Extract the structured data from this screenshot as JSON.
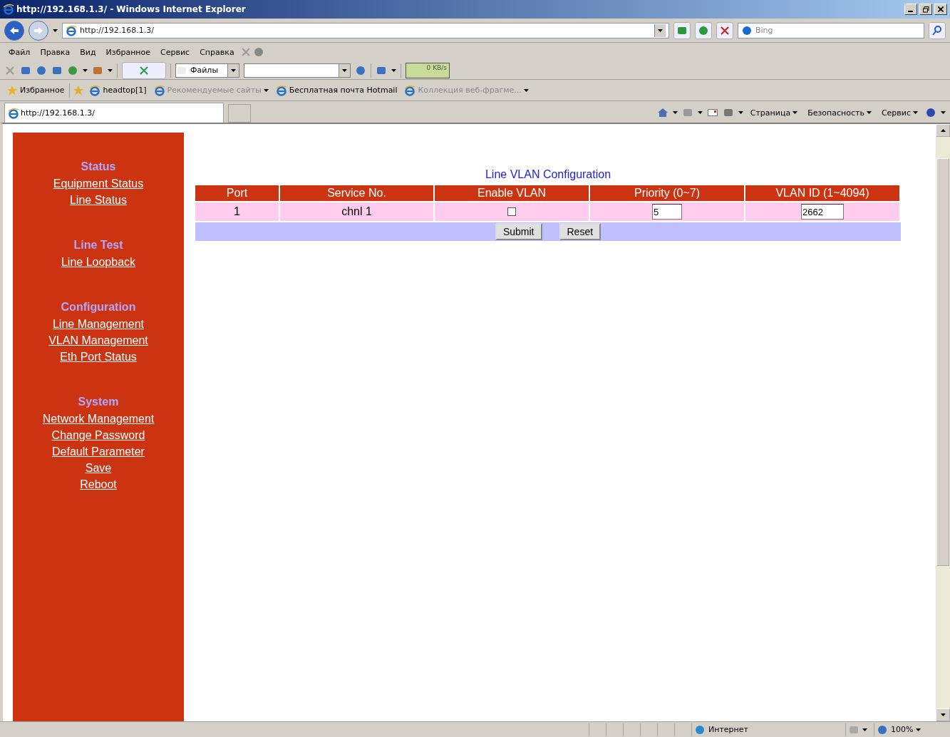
{
  "window": {
    "title": "http://192.168.1.3/ - Windows Internet Explorer"
  },
  "address_bar": {
    "url": "http://192.168.1.3/"
  },
  "search": {
    "placeholder": "Bing"
  },
  "menu": [
    "Файл",
    "Правка",
    "Вид",
    "Избранное",
    "Сервис",
    "Справка"
  ],
  "toolbar": {
    "dropdown": "Файлы",
    "speed": "0 KB/s"
  },
  "favorites": {
    "label": "Избранное",
    "items": [
      {
        "label": "headtop[1]",
        "disabled": false,
        "has_menu": false
      },
      {
        "label": "Рекомендуемые сайты",
        "disabled": true,
        "has_menu": true
      },
      {
        "label": "Бесплатная почта Hotmail",
        "disabled": false,
        "has_menu": false
      },
      {
        "label": "Коллекция веб-фрагме...",
        "disabled": true,
        "has_menu": true
      }
    ]
  },
  "tabs": [
    {
      "label": "http://192.168.1.3/",
      "selected": true
    }
  ],
  "command_bar": [
    "Страница",
    "Безопасность",
    "Сервис"
  ],
  "sidebar": {
    "sections": [
      {
        "heading": "Status",
        "links": [
          "Equipment Status",
          "Line Status"
        ]
      },
      {
        "heading": "Line Test",
        "links": [
          "Line Loopback"
        ]
      },
      {
        "heading": "Configuration",
        "links": [
          "Line Management",
          "VLAN Management",
          "Eth Port Status"
        ]
      },
      {
        "heading": "System",
        "links": [
          "Network Management",
          "Change Password",
          "Default Parameter",
          "Save",
          "Reboot"
        ]
      }
    ]
  },
  "form": {
    "title": "Line VLAN Configuration",
    "columns": [
      "Port",
      "Service No.",
      "Enable VLAN",
      "Priority (0~7)",
      "VLAN ID (1~4094)"
    ],
    "rows": [
      {
        "port": "1",
        "service": "chnl 1",
        "enable_vlan": false,
        "priority": "5",
        "vlan_id": "2662"
      }
    ],
    "buttons": [
      "Submit",
      "Reset"
    ]
  },
  "status_bar": {
    "zone": "Интернет",
    "zoom": "100%"
  }
}
